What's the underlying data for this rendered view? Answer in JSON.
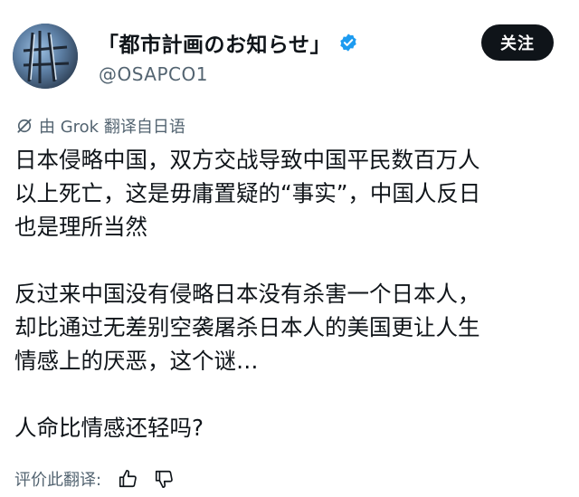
{
  "author": {
    "display_name": "「都市計画のお知らせ」",
    "handle": "@OSAPCO1",
    "verified": true,
    "avatar_icon": "avatar-image"
  },
  "follow_button": {
    "label": "关注"
  },
  "translation": {
    "label": "由 Grok 翻译自日语",
    "icon": "grok-icon"
  },
  "tweet": {
    "paragraphs": [
      [
        "日本侵略中国，双方交战导致中国平民数百万人",
        "以上死亡，这是毋庸置疑的“事实”，中国人反日",
        "也是理所当然"
      ],
      [
        "反过来中国没有侵略日本没有杀害一个日本人，",
        "却比通过无差别空袭屠杀日本人的美国更让人生",
        "情感上的厌恶，这个谜…"
      ],
      [
        "人命比情感还轻吗?"
      ]
    ]
  },
  "rating": {
    "label": "评价此翻译:",
    "thumb_up_icon": "thumbs-up-icon",
    "thumb_down_icon": "thumbs-down-icon"
  },
  "colors": {
    "text": "#0f1419",
    "secondary": "#536471",
    "verified_badge": "#1d9bf0",
    "follow_bg": "#0f1419"
  }
}
